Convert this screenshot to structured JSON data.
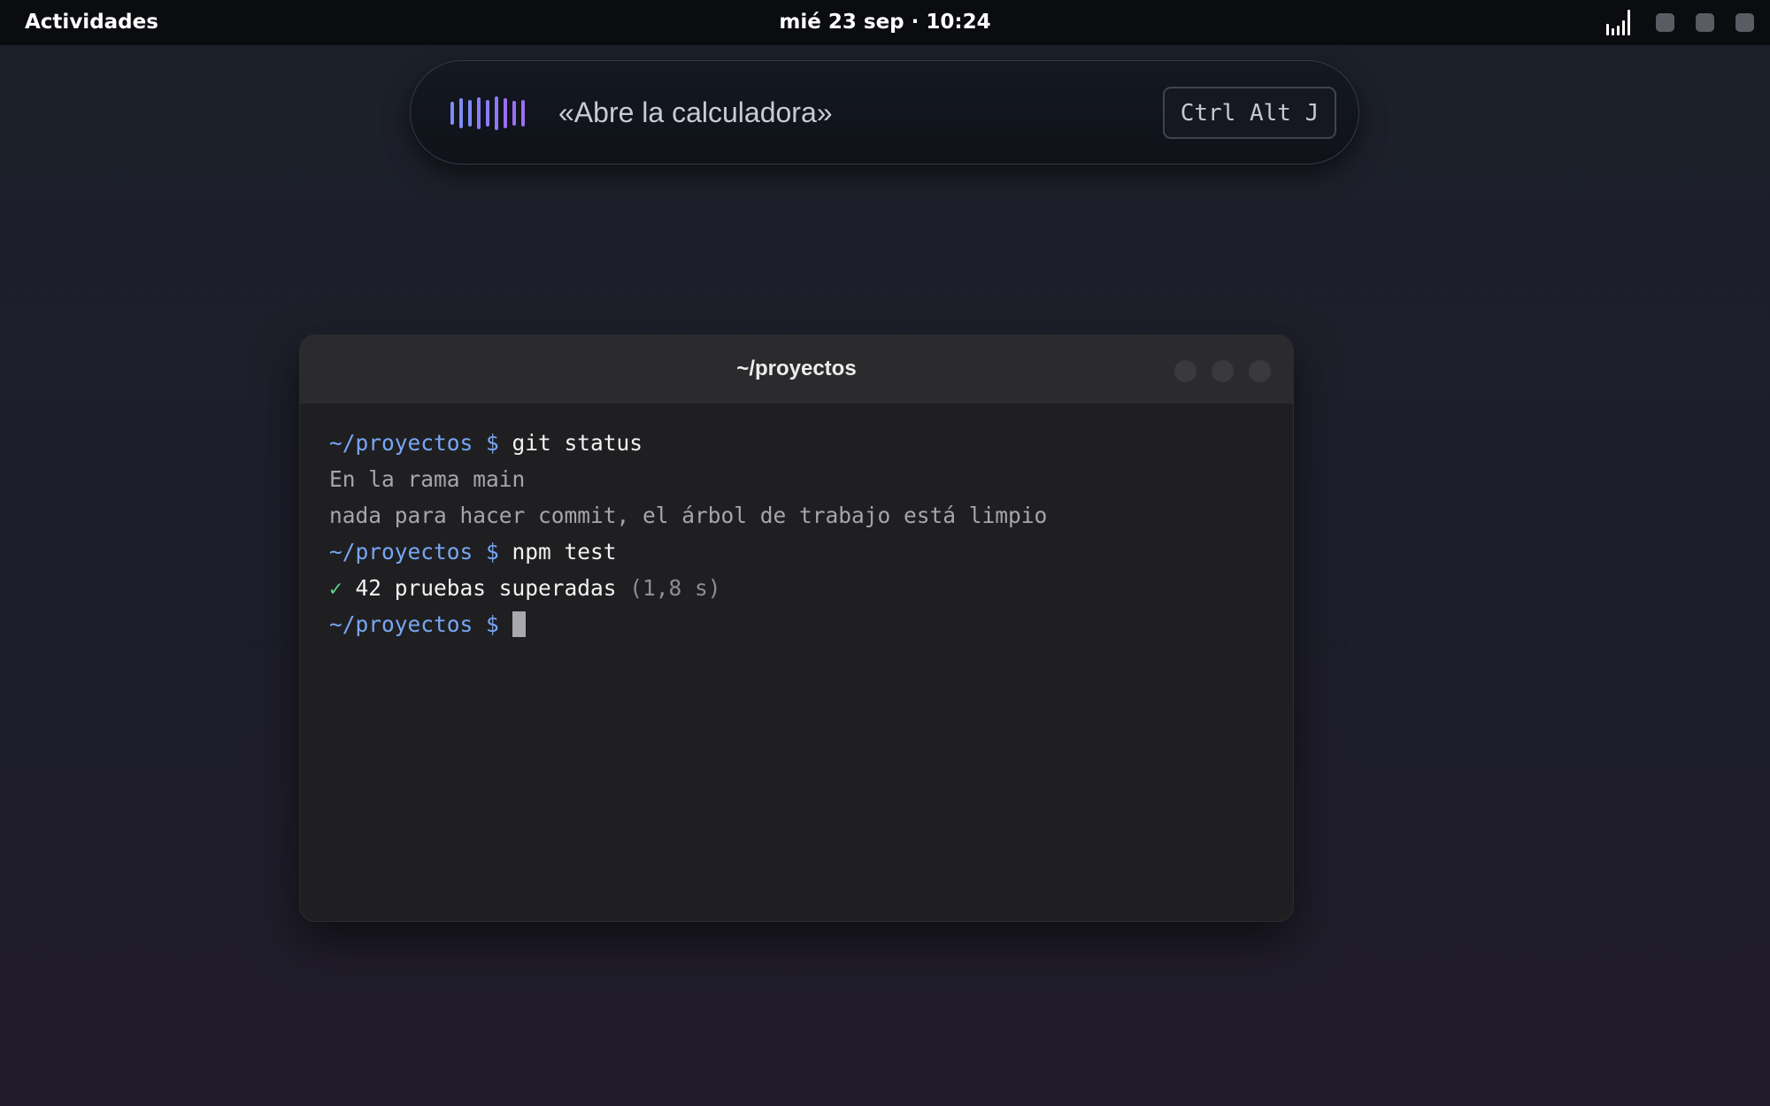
{
  "topbar": {
    "activities_label": "Actividades",
    "clock": "mié 23 sep · 10:24",
    "tray_icons": [
      "signal-icon",
      "tray-indicator",
      "tray-indicator",
      "tray-indicator"
    ]
  },
  "voice": {
    "transcript": "«Abre la calculadora»",
    "shortcut": "Ctrl Alt J",
    "waveform_colors": [
      "#7d8cf6",
      "#8a7df4",
      "#9a70ef"
    ]
  },
  "terminal": {
    "title": "~/proyectos",
    "lines": [
      {
        "prompt": "~/proyectos $ ",
        "command": "git status"
      },
      {
        "output": "En la rama main"
      },
      {
        "output": "nada para hacer commit, el árbol de trabajo está limpio"
      },
      {
        "prompt": "~/proyectos $ ",
        "command": "npm test"
      },
      {
        "check": "✓ ",
        "text": "42 pruebas superadas ",
        "detail": "(1,8 s)"
      },
      {
        "prompt": "~/proyectos $ "
      }
    ]
  },
  "colors": {
    "prompt": "#78a6f5",
    "success": "#5fd38d",
    "terminal_bg": "#1f1f21",
    "topbar_bg": "#0b0c10"
  }
}
